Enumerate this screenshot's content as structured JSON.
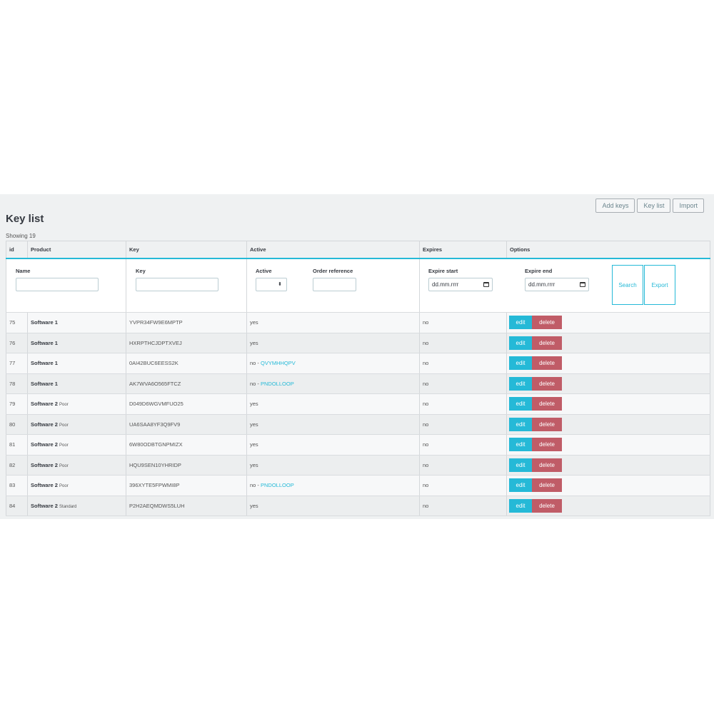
{
  "toolbar": {
    "add_keys": "Add keys",
    "key_list": "Key list",
    "import": "Import"
  },
  "page": {
    "title": "Key list",
    "showing": "Showing 19"
  },
  "table": {
    "headers": {
      "id": "id",
      "product": "Product",
      "key": "Key",
      "active": "Active",
      "expires": "Expires",
      "options": "Options"
    },
    "filters": {
      "name_label": "Name",
      "key_label": "Key",
      "active_label": "Active",
      "order_reference_label": "Order reference",
      "expire_start_label": "Expire start",
      "expire_end_label": "Expire end",
      "active_select_arrows": "⬍",
      "expire_start_placeholder": "dd.mm.rrrr",
      "expire_end_placeholder": "dd.mm.rrrr",
      "search_button": "Search",
      "export_button": "Export"
    },
    "rows": [
      {
        "id": "75",
        "product": "Software 1",
        "variant": "",
        "key": "YVPR34FW9E6MPTP",
        "active": "yes",
        "reference": "",
        "expires": "no"
      },
      {
        "id": "76",
        "product": "Software 1",
        "variant": "",
        "key": "HXRPTHCJDPTXVEJ",
        "active": "yes",
        "reference": "",
        "expires": "no"
      },
      {
        "id": "77",
        "product": "Software 1",
        "variant": "",
        "key": "0AI42BUC6EESS2K",
        "active": "no - ",
        "reference": "QVYMHHQPV",
        "expires": "no"
      },
      {
        "id": "78",
        "product": "Software 1",
        "variant": "",
        "key": "AK7WVA6O565FTCZ",
        "active": "no - ",
        "reference": "PNDOLLOOP",
        "expires": "no"
      },
      {
        "id": "79",
        "product": "Software 2",
        "variant": "Poor",
        "key": "D049D6WGVMFUO25",
        "active": "yes",
        "reference": "",
        "expires": "no"
      },
      {
        "id": "80",
        "product": "Software 2",
        "variant": "Poor",
        "key": "UA6SAA8YF3Q9FV9",
        "active": "yes",
        "reference": "",
        "expires": "no"
      },
      {
        "id": "81",
        "product": "Software 2",
        "variant": "Poor",
        "key": "6W80ODBTGNPMIZX",
        "active": "yes",
        "reference": "",
        "expires": "no"
      },
      {
        "id": "82",
        "product": "Software 2",
        "variant": "Poor",
        "key": "HQU9SEN10YHRIDP",
        "active": "yes",
        "reference": "",
        "expires": "no"
      },
      {
        "id": "83",
        "product": "Software 2",
        "variant": "Poor",
        "key": "396XYTE5FPWMI8P",
        "active": "no - ",
        "reference": "PNDOLLOOP",
        "expires": "no"
      },
      {
        "id": "84",
        "product": "Software 2",
        "variant": "Standard",
        "key": "P2H2AEQMDWS5LUH",
        "active": "yes",
        "reference": "",
        "expires": "no"
      }
    ],
    "row_actions": {
      "edit": "edit",
      "delete": "delete"
    }
  },
  "colors": {
    "accent": "#25b9d7",
    "danger": "#c05c67",
    "panel_bg": "#eff1f2"
  }
}
